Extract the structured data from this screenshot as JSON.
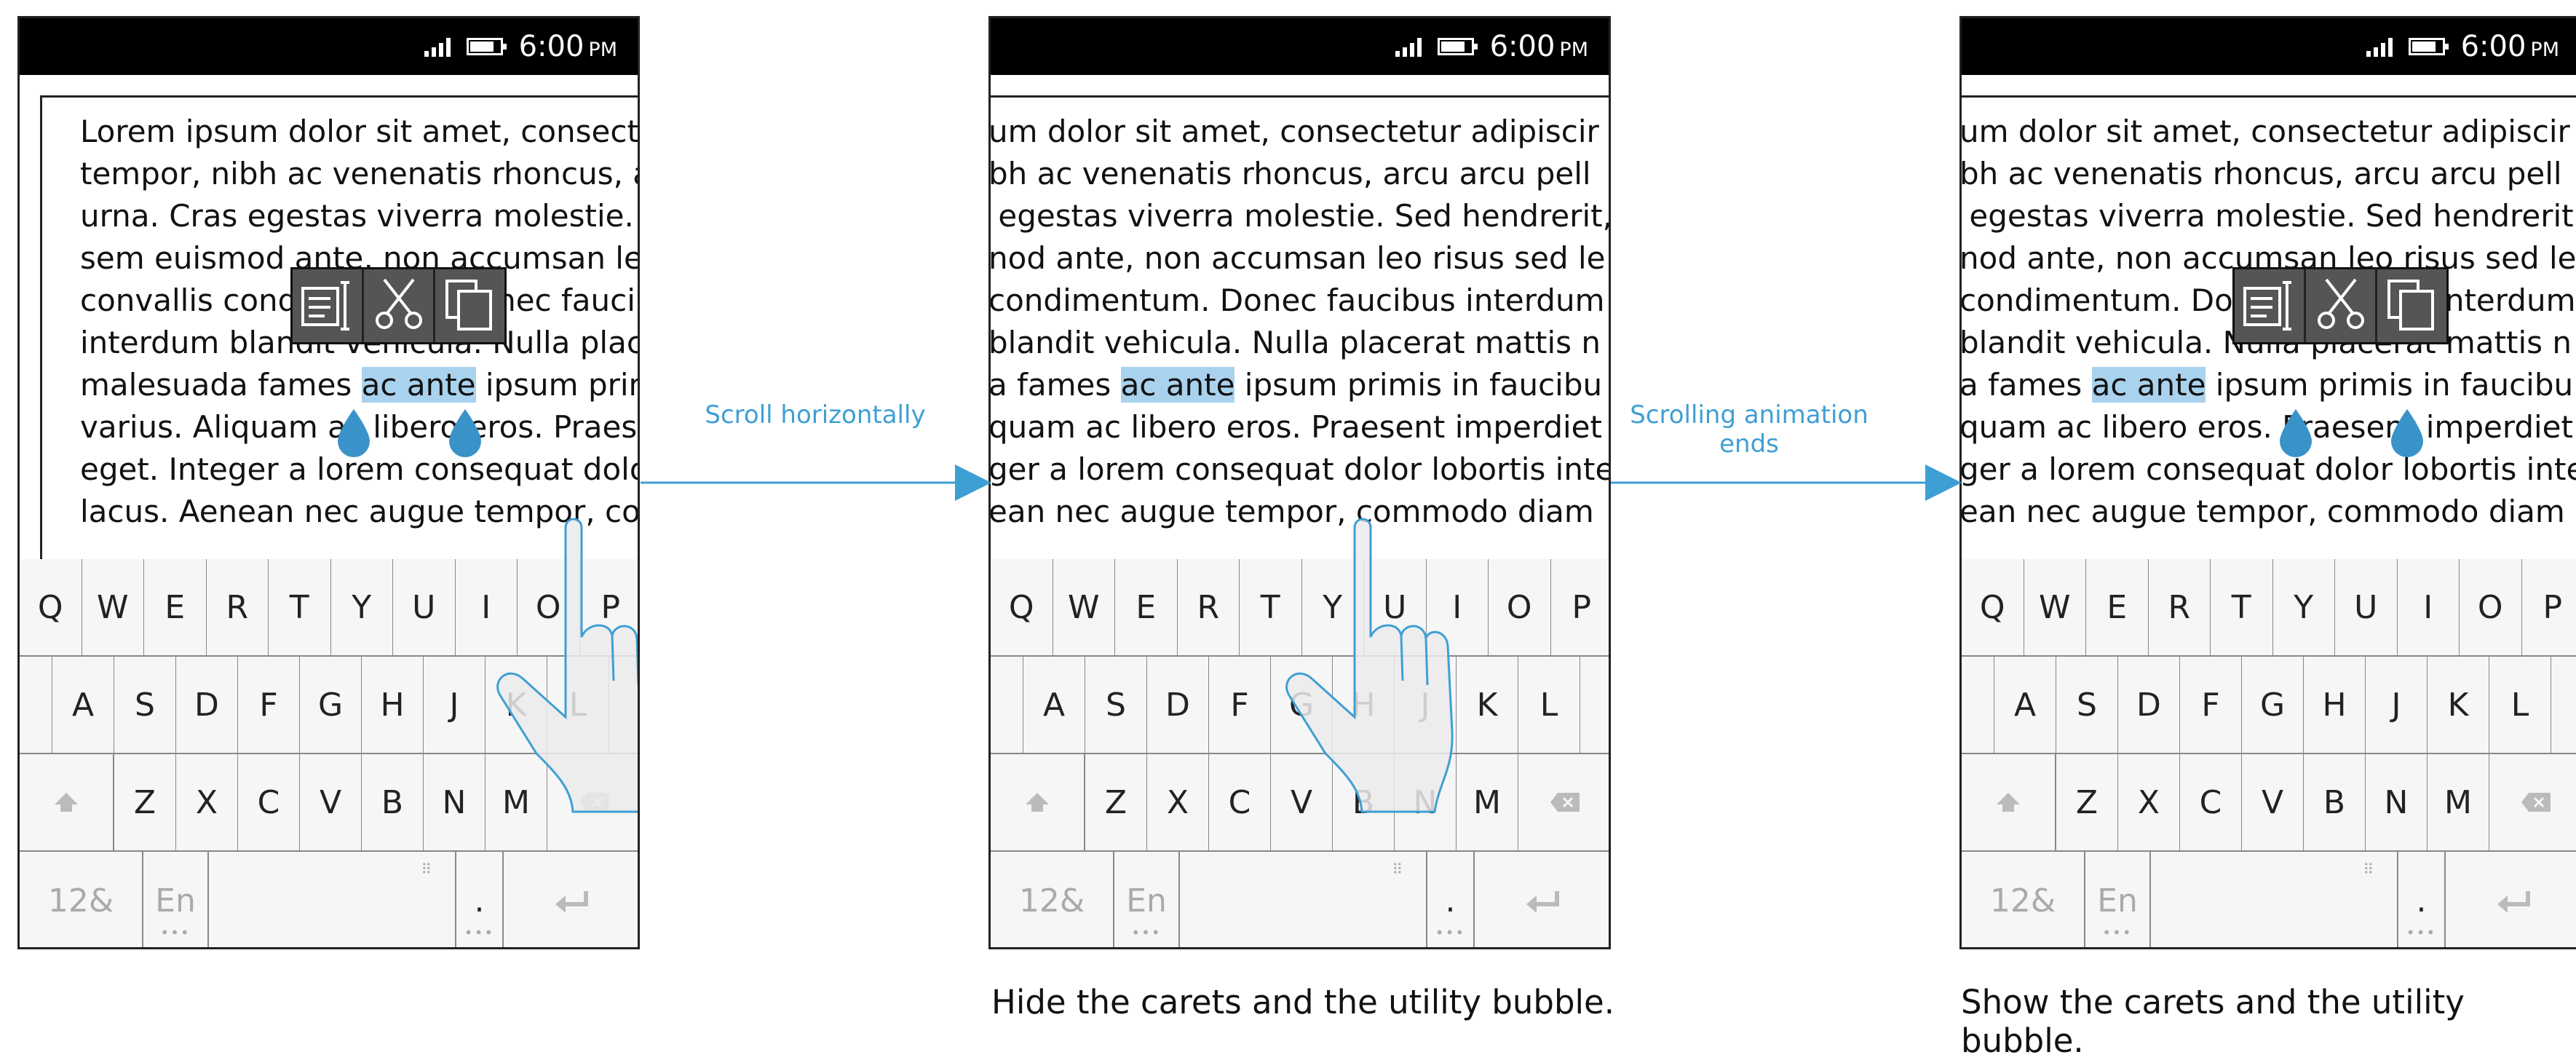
{
  "status_bar": {
    "time": "6:00",
    "ampm": "PM"
  },
  "panels": [
    {
      "lines": [
        [
          "Lorem ipsum dolor sit amet, consecte"
        ],
        [
          "tempor, nibh ac venenatis rhoncus, ar"
        ],
        [
          "urna. Cras egestas viverra molestie. Se"
        ],
        [
          "sem euismod ante, non accumsan leo"
        ],
        [
          "convallis condimentum. Donec faucib"
        ],
        [
          "interdum blandit vehicula. Nulla plac"
        ],
        [
          "malesuada fames ",
          "ac ante",
          " ipsum prim"
        ],
        [
          "varius. Aliquam ac libero eros. Praese"
        ],
        [
          "eget. Integer a lorem consequat dolor"
        ],
        [
          "lacus. Aenean nec augue tempor, com"
        ]
      ]
    },
    {
      "lines": [
        [
          "um dolor sit amet, consectetur adipiscir"
        ],
        [
          "bh ac venenatis rhoncus, arcu arcu pell"
        ],
        [
          " egestas viverra molestie. Sed hendrerit,"
        ],
        [
          "nod ante, non accumsan leo risus sed le"
        ],
        [
          "condimentum. Donec faucibus interdum"
        ],
        [
          "blandit vehicula. Nulla placerat mattis n"
        ],
        [
          "a fames ",
          "ac ante",
          " ipsum primis in faucibu"
        ],
        [
          "quam ac libero eros. Praesent imperdiet"
        ],
        [
          "ger a lorem consequat dolor lobortis inte"
        ],
        [
          "ean nec augue tempor, commodo diam"
        ]
      ]
    },
    {
      "lines": [
        [
          "um dolor sit amet, consectetur adipiscir"
        ],
        [
          "bh ac venenatis rhoncus, arcu arcu pell"
        ],
        [
          " egestas viverra molestie. Sed hendrerit"
        ],
        [
          "nod ante, non accumsan leo risus sed le"
        ],
        [
          "condimentum. Donec faucibus interdum"
        ],
        [
          "blandit vehicula. Nulla placerat mattis n"
        ],
        [
          "a fames ",
          "ac ante",
          " ipsum primis in faucibu"
        ],
        [
          "quam ac libero eros. Praesent imperdiet"
        ],
        [
          "ger a lorem consequat dolor lobortis inte"
        ],
        [
          "ean nec augue tempor, commodo diam"
        ]
      ]
    }
  ],
  "keyboard": {
    "row1": [
      "Q",
      "W",
      "E",
      "R",
      "T",
      "Y",
      "U",
      "I",
      "O",
      "P"
    ],
    "row2": [
      "A",
      "S",
      "D",
      "F",
      "G",
      "H",
      "J",
      "K",
      "L"
    ],
    "row3": [
      "Z",
      "X",
      "C",
      "V",
      "B",
      "N",
      "M"
    ],
    "numbers_key": "12&",
    "lang_key": "En",
    "period_key": "."
  },
  "arrows": [
    {
      "label": "Scroll horizontally"
    },
    {
      "label": "Scrolling animation ends"
    }
  ],
  "captions": [
    "Hide the carets and the utility bubble.",
    "Show the carets and the utility bubble."
  ],
  "colors": {
    "accent": "#3e9fd4",
    "caret": "#3a93c8",
    "selection": "#a9d2ee"
  }
}
